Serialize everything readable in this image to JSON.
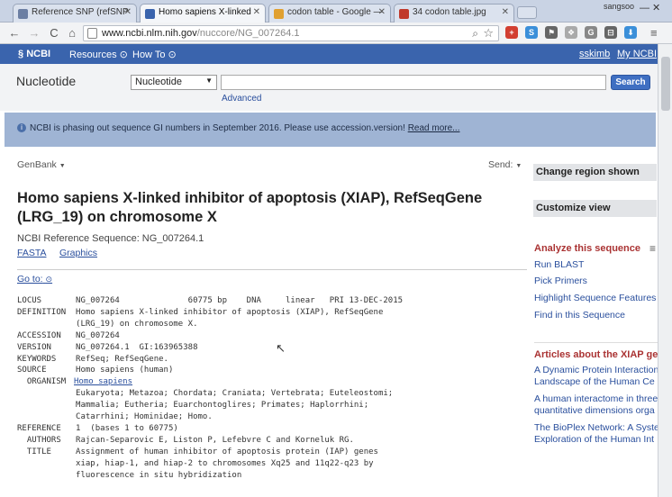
{
  "browser": {
    "tabs": [
      {
        "title": "Reference SNP (refSNP",
        "icon_color": "#6c7fa3"
      },
      {
        "title": "Homo sapiens X-linked",
        "icon_color": "#3a64ad"
      },
      {
        "title": "codon table - Google —",
        "icon_color": "#e0a030"
      },
      {
        "title": "34 codon table.jpg",
        "icon_color": "#c0392b"
      }
    ],
    "window_user": "sangsoo",
    "url_host": "www.ncbi.nlm.nih.gov",
    "url_path": "/nuccore/NG_007264.1",
    "ext_icons": [
      {
        "label": "+",
        "color": "#d23f31"
      },
      {
        "label": "S",
        "color": "#3b8fd9"
      },
      {
        "label": "⚑",
        "color": "#666"
      },
      {
        "label": "❖",
        "color": "#aaa"
      },
      {
        "label": "G",
        "color": "#888"
      },
      {
        "label": "⊟",
        "color": "#666"
      },
      {
        "label": "⬇",
        "color": "#3b8fd9"
      }
    ]
  },
  "ncbi_bar": {
    "logo": "NCBI",
    "resources": "Resources",
    "howto": "How To",
    "user": "sskimb",
    "myncbi": "My NCBI"
  },
  "search": {
    "db_title": "Nucleotide",
    "db_selected": "Nucleotide",
    "term": "",
    "button": "Search",
    "advanced": "Advanced"
  },
  "banner": {
    "text": "NCBI is phasing out sequence GI numbers in September 2016. Please use accession.version!",
    "link": "Read more..."
  },
  "record": {
    "format": "GenBank",
    "send": "Send:",
    "title_line1": "Homo sapiens X-linked inhibitor of apoptosis (XIAP), RefSeqGene",
    "title_line2": "(LRG_19) on chromosome X",
    "ref_seq": "NCBI Reference Sequence: NG_007264.1",
    "fasta": "FASTA",
    "graphics": "Graphics",
    "goto": "Go to:",
    "flat_file": [
      "LOCUS       NG_007264              60775 bp    DNA     linear   PRI 13-DEC-2015",
      "DEFINITION  Homo sapiens X-linked inhibitor of apoptosis (XIAP), RefSeqGene",
      "            (LRG_19) on chromosome X.",
      "ACCESSION   NG_007264",
      "VERSION     NG_007264.1  GI:163965388",
      "KEYWORDS    RefSeq; RefSeqGene.",
      "SOURCE      Homo sapiens (human)",
      "  ORGANISM  ",
      "            Eukaryota; Metazoa; Chordata; Craniata; Vertebrata; Euteleostomi;",
      "            Mammalia; Eutheria; Euarchontoglires; Primates; Haplorrhini;",
      "            Catarrhini; Hominidae; Homo.",
      "REFERENCE   1  (bases 1 to 60775)",
      "  AUTHORS   Rajcan-Separovic E, Liston P, Lefebvre C and Korneluk RG.",
      "  TITLE     Assignment of human inhibitor of apoptosis protein (IAP) genes",
      "            xiap, hiap-1, and hiap-2 to chromosomes Xq25 and 11q22-q23 by",
      "            fluorescence in situ hybridization"
    ],
    "organism_link": "Homo sapiens"
  },
  "right_panel": {
    "change_region": "Change region shown",
    "customize": "Customize view",
    "analyze_title": "Analyze this sequence",
    "analyze_items": [
      "Run BLAST",
      "Pick Primers",
      "Highlight Sequence Features",
      "Find in this Sequence"
    ],
    "articles_title": "Articles about the XIAP ge",
    "articles": [
      [
        "A Dynamic Protein Interaction",
        "Landscape of the Human Ce"
      ],
      [
        "A human interactome in three",
        "quantitative dimensions orga"
      ],
      [
        "The BioPlex Network: A Syste",
        "Exploration of the Human Int"
      ]
    ]
  }
}
